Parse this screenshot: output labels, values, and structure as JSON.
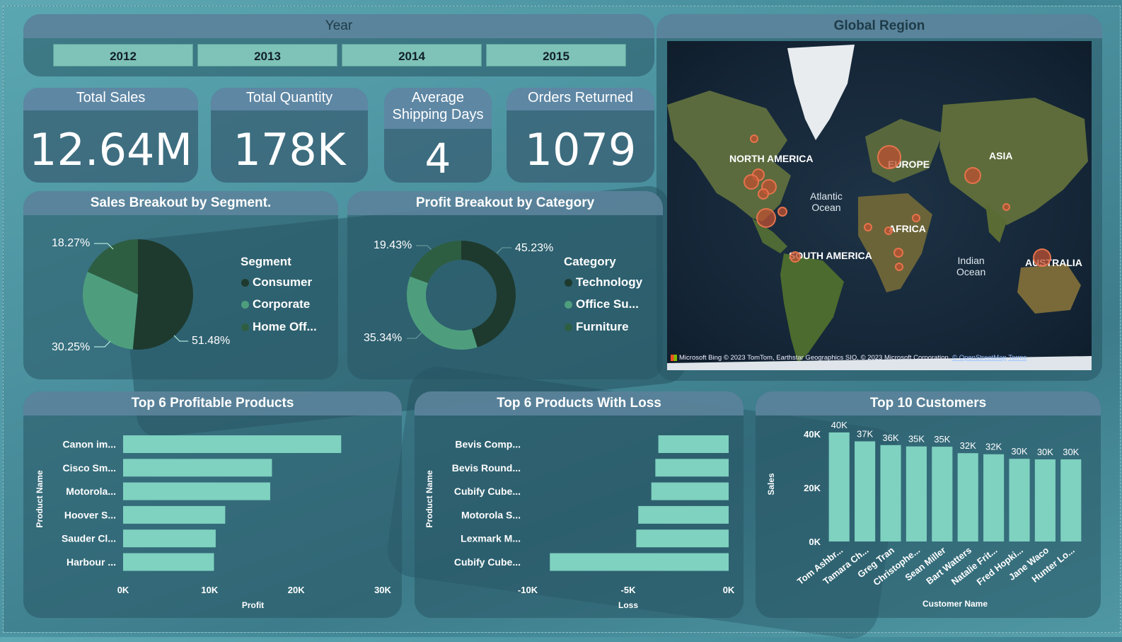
{
  "year_filter": {
    "title": "Year",
    "years": [
      "2012",
      "2013",
      "2014",
      "2015"
    ]
  },
  "kpis": {
    "total_sales": {
      "label": "Total Sales",
      "value": "12.64M"
    },
    "total_quantity": {
      "label": "Total Quantity",
      "value": "178K"
    },
    "avg_shipping": {
      "label_line1": "Average",
      "label_line2": "Shipping Days",
      "value": "4"
    },
    "orders_returned": {
      "label": "Orders Returned",
      "value": "1079"
    }
  },
  "map": {
    "title": "Global Region",
    "continents": [
      "NORTH AMERICA",
      "EUROPE",
      "ASIA",
      "AFRICA",
      "SOUTH AMERICA",
      "AUSTRALIA"
    ],
    "oceans": [
      {
        "line1": "Atlantic",
        "line2": "Ocean"
      },
      {
        "line1": "Indian",
        "line2": "Ocean"
      }
    ],
    "attribution_brand": "Microsoft Bing",
    "attribution_text": "© 2023 TomTom, Earthstar Geographics SIO, © 2023 Microsoft Corporation,",
    "attribution_link": "© OpenStreetMap",
    "attribution_terms": "Terms",
    "colors": {
      "bubble": "#c0523a"
    }
  },
  "segment_chart": {
    "title": "Sales Breakout by Segment.",
    "legend_title": "Segment",
    "colors": [
      "#1e3a2e",
      "#4e9e7e",
      "#2e5e42"
    ],
    "chart_data": {
      "type": "pie",
      "categories": [
        "Consumer",
        "Corporate",
        "Home Off..."
      ],
      "values": [
        51.48,
        30.25,
        18.27
      ],
      "labels": [
        "51.48%",
        "30.25%",
        "18.27%"
      ]
    }
  },
  "category_chart": {
    "title": "Profit Breakout by Category",
    "legend_title": "Category",
    "colors": [
      "#1e3a2e",
      "#4e9e7e",
      "#2e5e42"
    ],
    "chart_data": {
      "type": "pie",
      "categories": [
        "Technology",
        "Office Su...",
        "Furniture"
      ],
      "values": [
        45.23,
        35.34,
        19.43
      ],
      "labels": [
        "45.23%",
        "35.34%",
        "19.43%"
      ]
    }
  },
  "profitable_chart": {
    "title": "Top 6 Profitable Products",
    "chart_data": {
      "type": "bar",
      "orientation": "horizontal",
      "categories": [
        "Canon im...",
        "Cisco Sm...",
        "Motorola...",
        "Hoover S...",
        "Sauder Cl...",
        "Harbour ..."
      ],
      "values": [
        25200,
        17200,
        17000,
        11800,
        10700,
        10500
      ],
      "xlabel": "Profit",
      "ylabel": "Product Name",
      "xlim": [
        0,
        30000
      ],
      "ticks": [
        "0K",
        "10K",
        "20K",
        "30K"
      ]
    }
  },
  "loss_chart": {
    "title": "Top 6 Products With Loss",
    "chart_data": {
      "type": "bar",
      "orientation": "horizontal",
      "categories": [
        "Bevis Comp...",
        "Bevis Round...",
        "Cubify Cube...",
        "Motorola S...",
        "Lexmark M...",
        "Cubify Cube..."
      ],
      "values": [
        -3500,
        -3650,
        -3850,
        -4500,
        -4600,
        -8900
      ],
      "xlabel": "Loss",
      "ylabel": "Product Name",
      "xlim": [
        -10000,
        0
      ],
      "ticks": [
        "-10K",
        "-5K",
        "0K"
      ]
    }
  },
  "customers_chart": {
    "title": "Top 10 Customers",
    "chart_data": {
      "type": "bar",
      "categories": [
        "Tom Ashbr...",
        "Tamara Ch...",
        "Greg Tran",
        "Christophe...",
        "Sean Miller",
        "Bart Watters",
        "Natalie Frit...",
        "Fred Hopki...",
        "Jane Waco",
        "Hunter Lo..."
      ],
      "values": [
        40500,
        37200,
        35800,
        35300,
        35200,
        32800,
        32400,
        30700,
        30500,
        30500
      ],
      "data_labels": [
        "40K",
        "37K",
        "36K",
        "35K",
        "35K",
        "32K",
        "32K",
        "30K",
        "30K",
        "30K"
      ],
      "xlabel": "Customer Name",
      "ylabel": "Sales",
      "ylim": [
        0,
        46000
      ],
      "ticks": [
        "0K",
        "20K",
        "40K"
      ]
    }
  },
  "bar_color": "#7fd1c0"
}
